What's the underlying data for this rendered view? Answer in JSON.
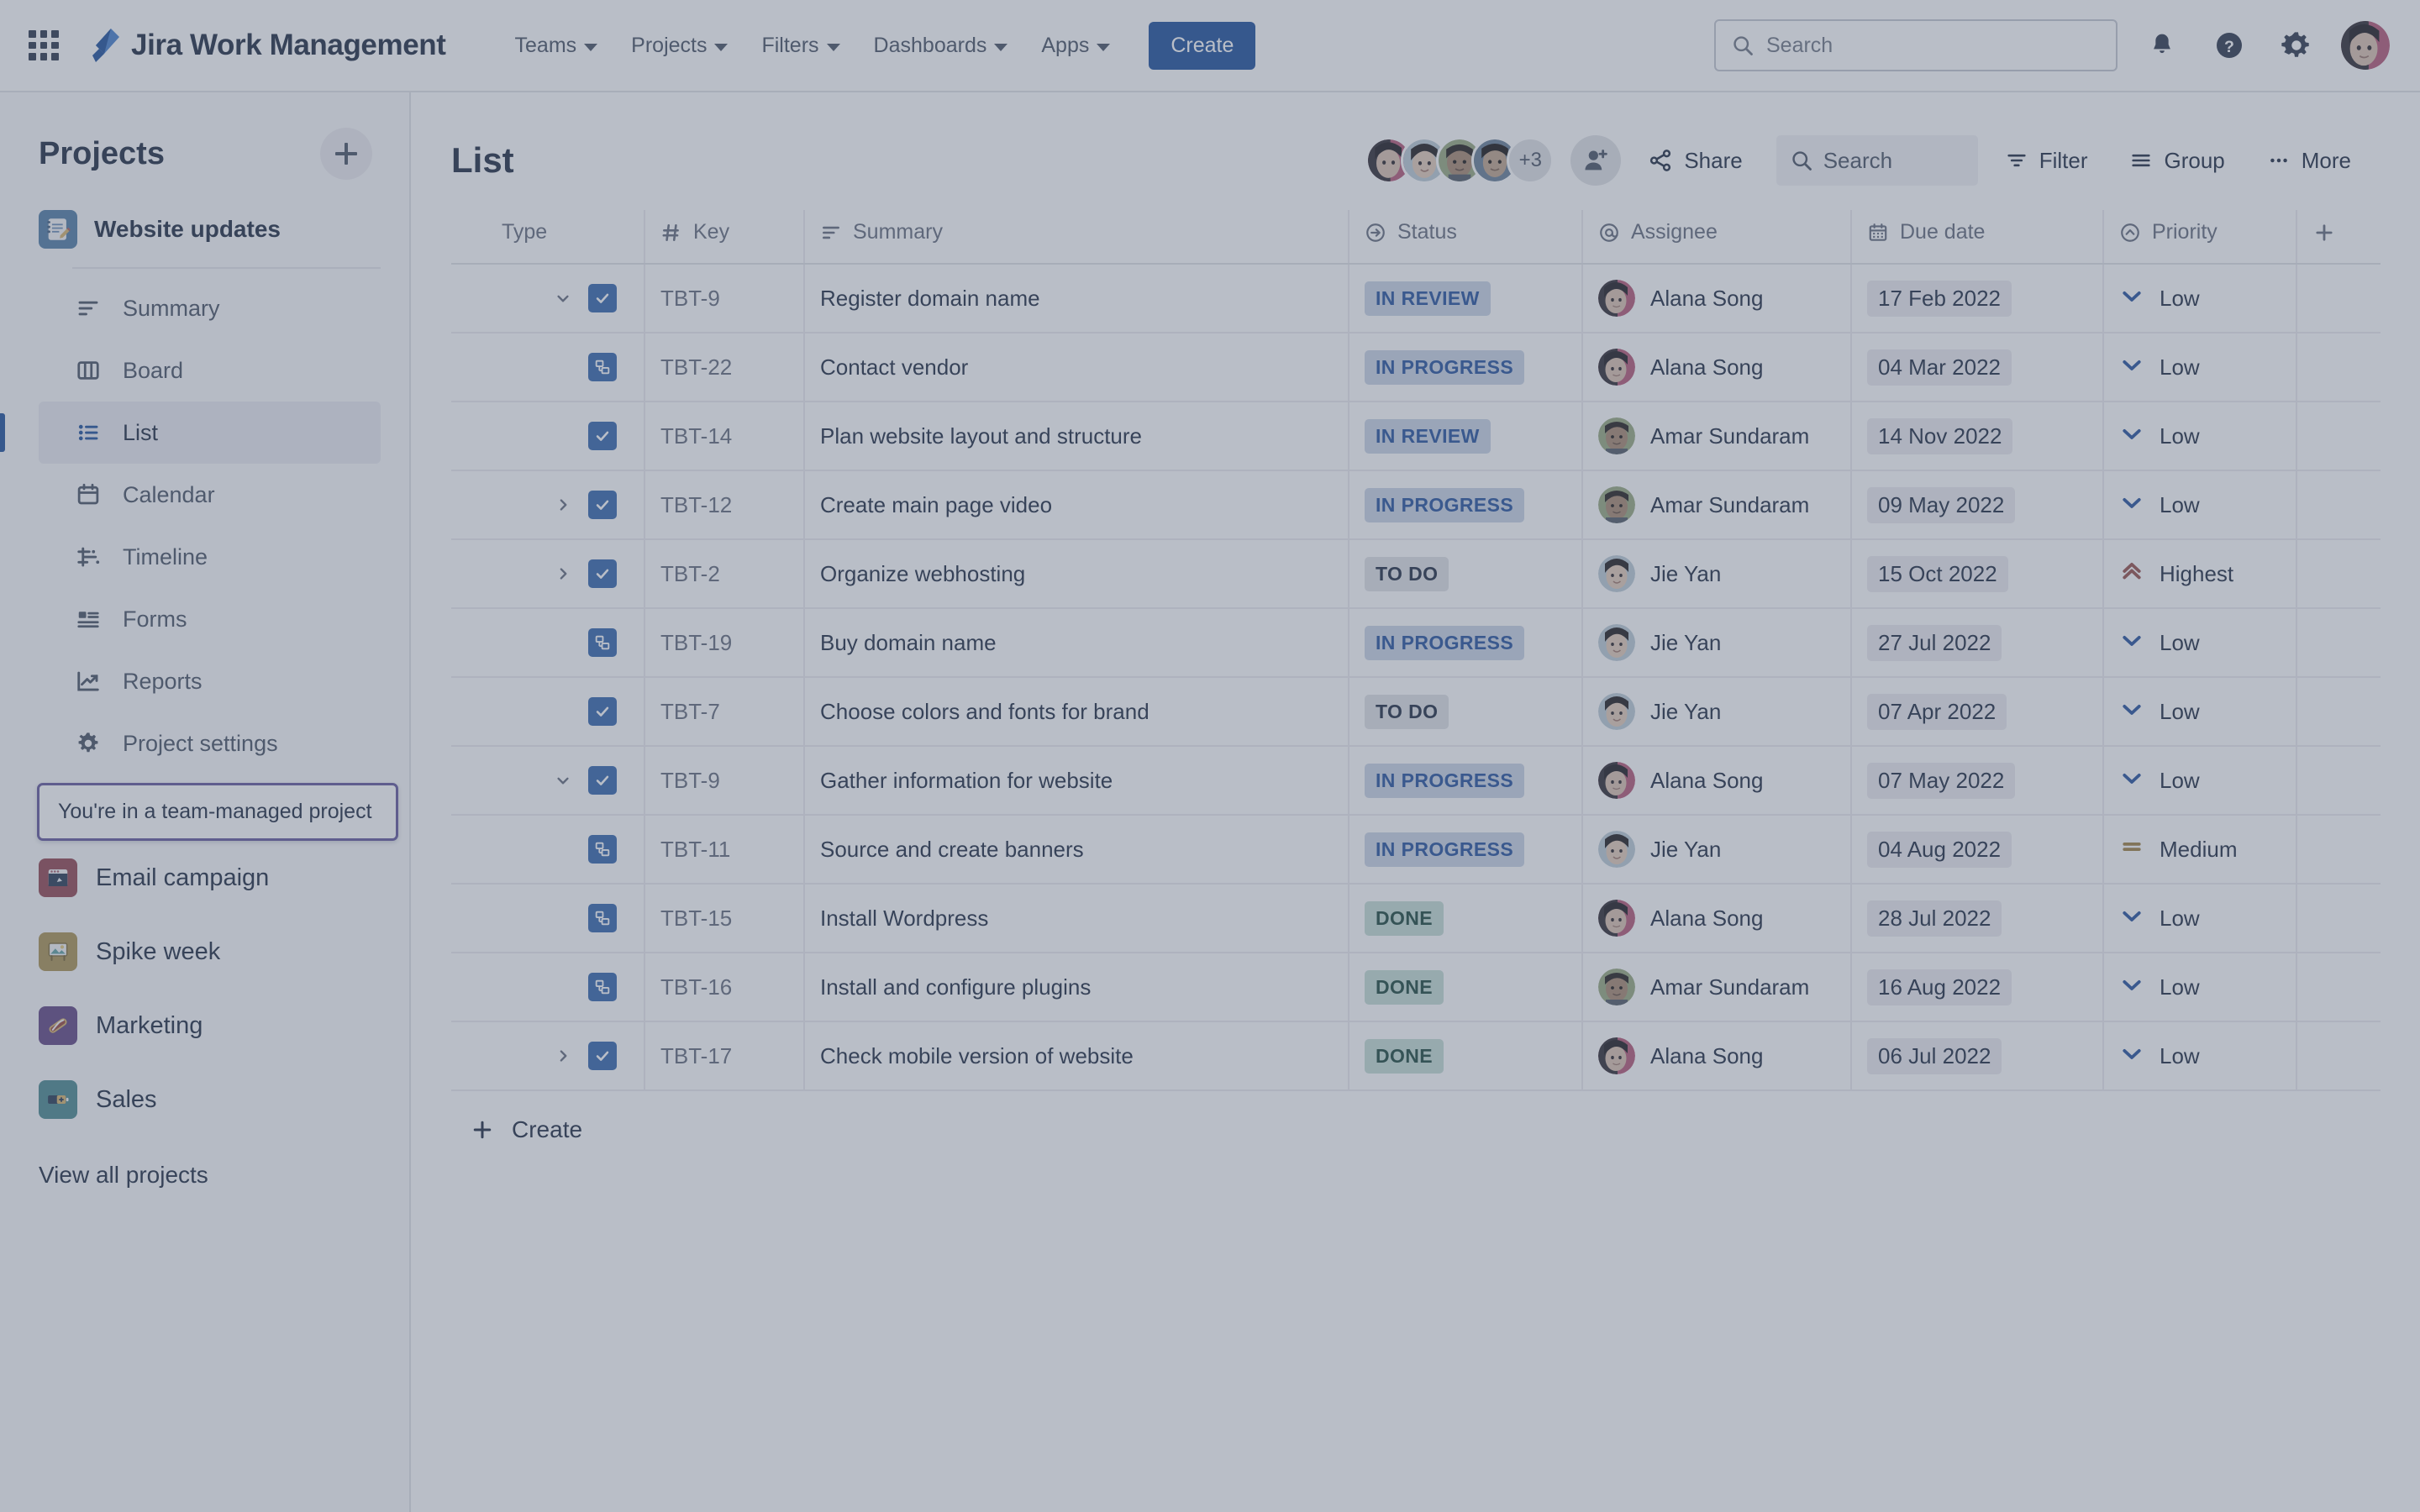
{
  "topnav": {
    "app_switcher_icon": "grid-apps-icon",
    "brand_logo_icon": "jira-logo-icon",
    "brand_name": "Jira Work Management",
    "links": [
      {
        "label": "Teams"
      },
      {
        "label": "Projects"
      },
      {
        "label": "Filters"
      },
      {
        "label": "Dashboards"
      },
      {
        "label": "Apps"
      }
    ],
    "create_label": "Create",
    "search_placeholder": "Search",
    "search_icon": "search-icon",
    "notifications_icon": "bell-icon",
    "help_icon": "help-circle-icon",
    "settings_icon": "gear-icon",
    "profile_icon": "user-avatar"
  },
  "sidebar": {
    "title": "Projects",
    "add_icon": "plus-icon",
    "project": {
      "name": "Website updates",
      "icon": "notebook-pencil-icon",
      "items": [
        {
          "label": "Summary",
          "icon": "summary-icon",
          "selected": false
        },
        {
          "label": "Board",
          "icon": "board-icon",
          "selected": false
        },
        {
          "label": "List",
          "icon": "list-icon",
          "selected": true
        },
        {
          "label": "Calendar",
          "icon": "calendar-icon",
          "selected": false
        },
        {
          "label": "Timeline",
          "icon": "timeline-icon",
          "selected": false
        },
        {
          "label": "Forms",
          "icon": "forms-icon",
          "selected": false
        },
        {
          "label": "Reports",
          "icon": "reports-icon",
          "selected": false
        },
        {
          "label": "Project settings",
          "icon": "gear-icon",
          "selected": false
        }
      ]
    },
    "tooltip": "You're in a team-managed project",
    "tooltip_border_color": "#6554c0",
    "other_projects": [
      {
        "label": "Email campaign",
        "icon": "browser-window-icon",
        "color": "#b83a4b"
      },
      {
        "label": "Spike week",
        "icon": "photo-frame-icon",
        "color": "#b8912b"
      },
      {
        "label": "Marketing",
        "icon": "hotdog-icon",
        "color": "#6b3fa0"
      },
      {
        "label": "Sales",
        "icon": "battery-icon",
        "color": "#2a8f99"
      }
    ],
    "view_all": "View all projects"
  },
  "main": {
    "page_title": "List",
    "avatars_extra": "+3",
    "add_people_icon": "add-person-icon",
    "share_label": "Share",
    "share_icon": "share-icon",
    "search_placeholder": "Search",
    "search_icon": "search-icon",
    "filter_label": "Filter",
    "filter_icon": "filter-icon",
    "group_label": "Group",
    "group_icon": "group-lines-icon",
    "more_label": "More",
    "more_icon": "ellipsis-icon",
    "add_column_icon": "plus-icon",
    "create_label": "Create",
    "create_icon": "plus-icon",
    "columns": [
      {
        "label": "Type",
        "icon": null
      },
      {
        "label": "Key",
        "icon": "hash-icon"
      },
      {
        "label": "Summary",
        "icon": "summary-icon"
      },
      {
        "label": "Status",
        "icon": "arrow-circle-icon"
      },
      {
        "label": "Assignee",
        "icon": "at-icon"
      },
      {
        "label": "Due date",
        "icon": "calendar-icon"
      },
      {
        "label": "Priority",
        "icon": "chevron-circle-icon"
      }
    ],
    "rows": [
      {
        "expander": "down",
        "type": "task",
        "key": "TBT-9",
        "summary": "Register domain name",
        "status": "IN REVIEW",
        "status_kind": "inreview",
        "assignee": "Alana Song",
        "avatar": "alana",
        "due": "17 Feb 2022",
        "priority": "Low",
        "priority_kind": "low"
      },
      {
        "expander": "none",
        "type": "subtask",
        "key": "TBT-22",
        "summary": "Contact vendor",
        "status": "IN PROGRESS",
        "status_kind": "inprogress",
        "assignee": "Alana Song",
        "avatar": "alana",
        "due": "04 Mar 2022",
        "priority": "Low",
        "priority_kind": "low"
      },
      {
        "expander": "none",
        "type": "task",
        "key": "TBT-14",
        "summary": "Plan website layout and structure",
        "status": "IN REVIEW",
        "status_kind": "inreview",
        "assignee": "Amar Sundaram",
        "avatar": "amar",
        "due": "14 Nov 2022",
        "priority": "Low",
        "priority_kind": "low"
      },
      {
        "expander": "right",
        "type": "task",
        "key": "TBT-12",
        "summary": "Create main page video",
        "status": "IN PROGRESS",
        "status_kind": "inprogress",
        "assignee": "Amar Sundaram",
        "avatar": "amar",
        "due": "09 May 2022",
        "priority": "Low",
        "priority_kind": "low"
      },
      {
        "expander": "right",
        "type": "task",
        "key": "TBT-2",
        "summary": "Organize webhosting",
        "status": "TO DO",
        "status_kind": "todo",
        "assignee": "Jie Yan",
        "avatar": "jie",
        "due": "15 Oct 2022",
        "priority": "Highest",
        "priority_kind": "highest"
      },
      {
        "expander": "none",
        "type": "subtask",
        "key": "TBT-19",
        "summary": "Buy domain name",
        "status": "IN PROGRESS",
        "status_kind": "inprogress",
        "assignee": "Jie Yan",
        "avatar": "jie",
        "due": "27 Jul 2022",
        "priority": "Low",
        "priority_kind": "low"
      },
      {
        "expander": "none",
        "type": "task",
        "key": "TBT-7",
        "summary": "Choose colors and fonts for brand",
        "status": "TO DO",
        "status_kind": "todo",
        "assignee": "Jie Yan",
        "avatar": "jie",
        "due": "07 Apr 2022",
        "priority": "Low",
        "priority_kind": "low"
      },
      {
        "expander": "down",
        "type": "task",
        "key": "TBT-9",
        "summary": "Gather information for website",
        "status": "IN PROGRESS",
        "status_kind": "inprogress",
        "assignee": "Alana Song",
        "avatar": "alana",
        "due": "07 May 2022",
        "priority": "Low",
        "priority_kind": "low"
      },
      {
        "expander": "none",
        "type": "subtask",
        "key": "TBT-11",
        "summary": "Source and create banners",
        "status": "IN PROGRESS",
        "status_kind": "inprogress",
        "assignee": "Jie Yan",
        "avatar": "jie",
        "due": "04 Aug 2022",
        "priority": "Medium",
        "priority_kind": "medium"
      },
      {
        "expander": "none",
        "type": "subtask",
        "key": "TBT-15",
        "summary": "Install Wordpress",
        "status": "DONE",
        "status_kind": "done",
        "assignee": "Alana Song",
        "avatar": "alana",
        "due": "28 Jul 2022",
        "priority": "Low",
        "priority_kind": "low"
      },
      {
        "expander": "none",
        "type": "subtask",
        "key": "TBT-16",
        "summary": "Install and configure plugins",
        "status": "DONE",
        "status_kind": "done",
        "assignee": "Amar Sundaram",
        "avatar": "amar",
        "due": "16 Aug 2022",
        "priority": "Low",
        "priority_kind": "low"
      },
      {
        "expander": "right",
        "type": "task",
        "key": "TBT-17",
        "summary": "Check mobile version of website",
        "status": "DONE",
        "status_kind": "done",
        "assignee": "Alana Song",
        "avatar": "alana",
        "due": "06 Jul 2022",
        "priority": "Low",
        "priority_kind": "low"
      }
    ]
  },
  "colors": {
    "brand_blue": "#0052cc",
    "text_primary": "#172b4d",
    "text_muted": "#5e6c84",
    "status_blue_bg": "#c3d4f0",
    "status_blue_text": "#0b52cd",
    "status_gray_bg": "#dfe1e6",
    "status_green_bg": "#b7dfd3",
    "status_green_text": "#064c3a",
    "priority_low": "#0b52cd",
    "priority_medium": "#b07d18",
    "priority_highest": "#b8453c",
    "tooltip_border": "#6554c0"
  }
}
